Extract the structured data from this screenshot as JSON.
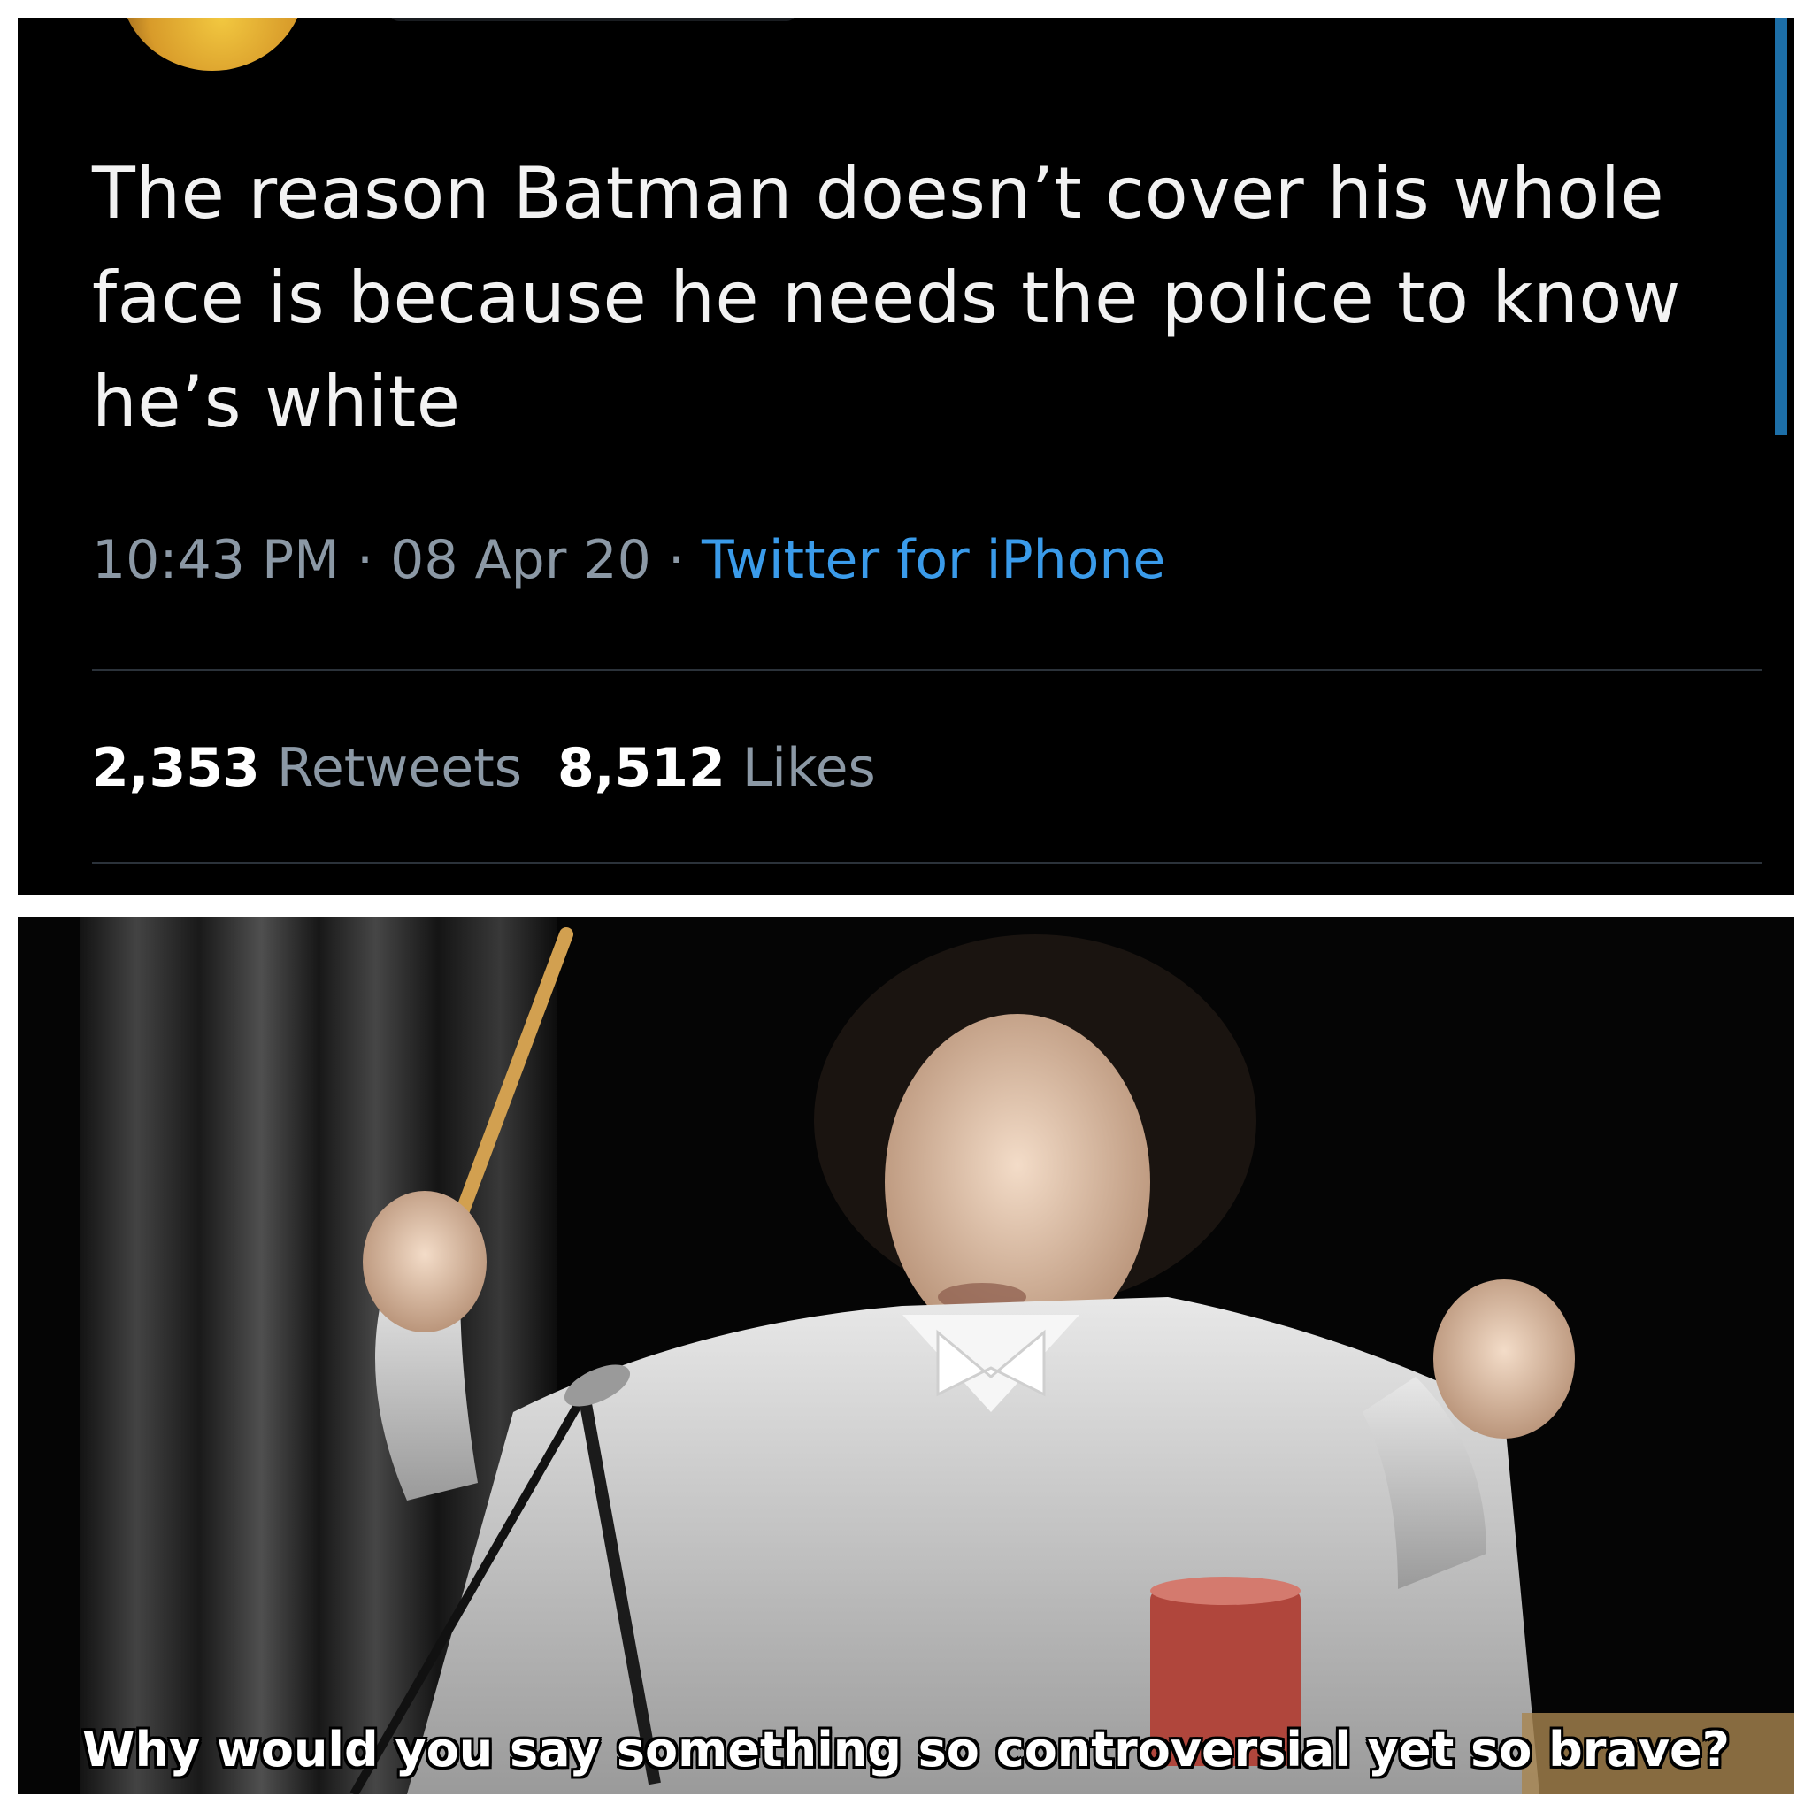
{
  "tweet": {
    "text": "The reason Batman doesn’t cover his whole face is because he needs the police to know he’s white",
    "time": "10:43 PM",
    "separator": "·",
    "date": "08 Apr 20",
    "source": "Twitter for iPhone",
    "retweets_count": "2,353",
    "retweets_label": "Retweets",
    "likes_count": "8,512",
    "likes_label": "Likes",
    "source_color": "#3a9bea"
  },
  "meme": {
    "caption": "Why would you say something so controversial yet so brave?"
  }
}
